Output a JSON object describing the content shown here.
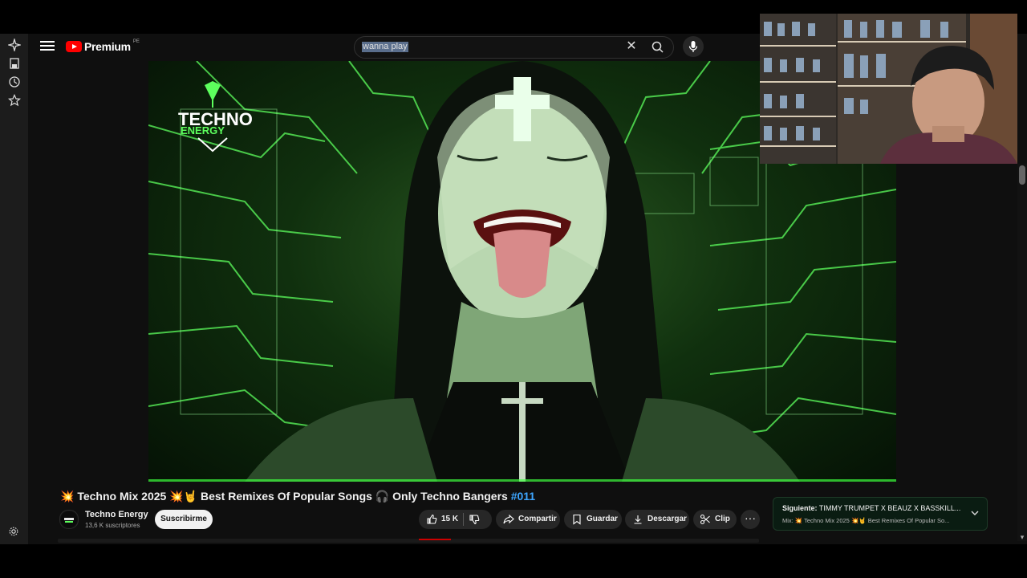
{
  "header": {
    "logo_word": "Premium",
    "country_code": "PE",
    "search_value": "wanna play"
  },
  "video": {
    "watermark_line1": "TECHNO",
    "watermark_line2": "ENERGY"
  },
  "meta": {
    "title_part1": "Techno Mix 2025",
    "title_part2": "Best Remixes Of Popular Songs",
    "title_part3": "Only Techno Bangers",
    "hashtag": "#011",
    "channel_name": "Techno Energy",
    "subscribers": "13,6 K suscriptores",
    "subscribe_label": "Suscribirme",
    "likes": "15 K",
    "share_label": "Compartir",
    "save_label": "Guardar",
    "download_label": "Descargar",
    "clip_label": "Clip",
    "more_label": "···"
  },
  "up_next": {
    "label": "Siguiente:",
    "title": "TIMMY TRUMPET X BEAUZ X BASSKILL...",
    "mix_prefix": "Mix:",
    "mix_part1": "Techno Mix 2025",
    "mix_part2": "Best Remixes Of Popular So..."
  },
  "colors": {
    "accent_red": "#ff0000",
    "hashtag_blue": "#3ea6ff",
    "video_green": "#3fff3f"
  },
  "icons": [
    "sparkle-icon",
    "save-icon",
    "history-icon",
    "star-icon",
    "menu-icon",
    "clear-icon",
    "search-icon",
    "mic-icon",
    "like-icon",
    "dislike-icon",
    "share-icon",
    "bookmark-icon",
    "download-icon",
    "scissors-icon",
    "chevron-down-icon",
    "gear-icon"
  ]
}
